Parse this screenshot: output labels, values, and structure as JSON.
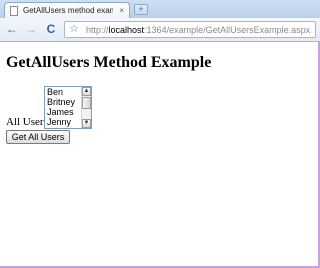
{
  "browser": {
    "tab": {
      "title": "GetAllUsers method exampl...",
      "close": "×"
    },
    "new_tab": "+",
    "nav": {
      "back": "←",
      "forward": "→",
      "reload": "C"
    },
    "address_bar": {
      "star": "☆",
      "scheme": "http://",
      "host": "localhost",
      "rest": ":1364/example/GetAllUsersExample.aspx"
    }
  },
  "page": {
    "heading": "GetAllUsers Method Example",
    "users_label": "All Users",
    "users": [
      "Ben",
      "Britney",
      "James",
      "Jenny"
    ],
    "get_all_button": "Get All Users"
  }
}
